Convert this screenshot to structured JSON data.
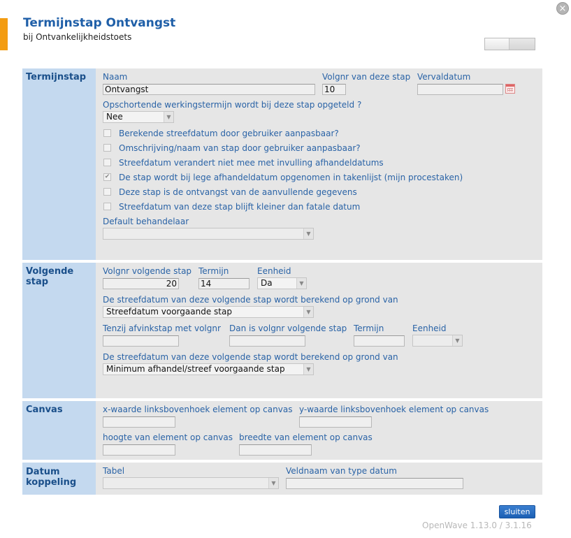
{
  "header": {
    "title": "Termijnstap Ontvangst",
    "subtitle": "bij Ontvankelijkheidstoets",
    "close_glyph": "×"
  },
  "termijnstap": {
    "section_label": "Termijnstap",
    "naam_label": "Naam",
    "naam_value": "Ontvangst",
    "volgnr_label": "Volgnr van deze stap",
    "volgnr_value": "10",
    "vervaldatum_label": "Vervaldatum",
    "vervaldatum_value": "",
    "opschortende_label": "Opschortende werkingstermijn wordt bij deze stap opgeteld ?",
    "opschortende_value": "Nee",
    "checkboxes": [
      {
        "label": "Berekende streefdatum door gebruiker aanpasbaar?",
        "checked": false
      },
      {
        "label": "Omschrijving/naam van stap door gebruiker aanpasbaar?",
        "checked": false
      },
      {
        "label": "Streefdatum verandert niet mee met invulling afhandeldatums",
        "checked": false
      },
      {
        "label": "De stap wordt bij lege afhandeldatum opgenomen in takenlijst (mijn procestaken)",
        "checked": true
      },
      {
        "label": "Deze stap is de ontvangst van de aanvullende gegevens",
        "checked": false
      },
      {
        "label": "Streefdatum van deze stap blijft kleiner dan fatale datum",
        "checked": false
      }
    ],
    "default_behandelaar_label": "Default behandelaar",
    "default_behandelaar_value": ""
  },
  "volgende_stap": {
    "section_label": "Volgende stap",
    "volgnr_volgende_label": "Volgnr volgende stap",
    "volgnr_volgende_value": "20",
    "termijn_label": "Termijn",
    "termijn_value": "14",
    "eenheid_label": "Eenheid",
    "eenheid_value": "Da",
    "streefdatum_label_1": "De streefdatum van deze volgende stap wordt berekend op grond van",
    "streefdatum_value_1": "Streefdatum voorgaande stap",
    "tenzij_label": "Tenzij afvinkstap met volgnr",
    "tenzij_value": "",
    "dan_label": "Dan is volgnr volgende stap",
    "dan_value": "",
    "termijn2_label": "Termijn",
    "termijn2_value": "",
    "eenheid2_label": "Eenheid",
    "eenheid2_value": "",
    "streefdatum_label_2": "De streefdatum van deze volgende stap wordt berekend op grond van",
    "streefdatum_value_2": "Minimum afhandel/streef voorgaande stap"
  },
  "canvas": {
    "section_label": "Canvas",
    "x_label": "x-waarde linksbovenhoek element op canvas",
    "x_value": "",
    "y_label": "y-waarde linksbovenhoek element op canvas",
    "y_value": "",
    "hoogte_label": "hoogte van element op canvas",
    "hoogte_value": "",
    "breedte_label": "breedte van element op canvas",
    "breedte_value": ""
  },
  "datum_koppeling": {
    "section_label_line1": "Datum",
    "section_label_line2": "koppeling",
    "tabel_label": "Tabel",
    "tabel_value": "",
    "veldnaam_label": "Veldnaam van type datum",
    "veldnaam_value": ""
  },
  "footer": {
    "close_button": "sluiten",
    "version": "OpenWave 1.13.0 / 3.1.16"
  }
}
